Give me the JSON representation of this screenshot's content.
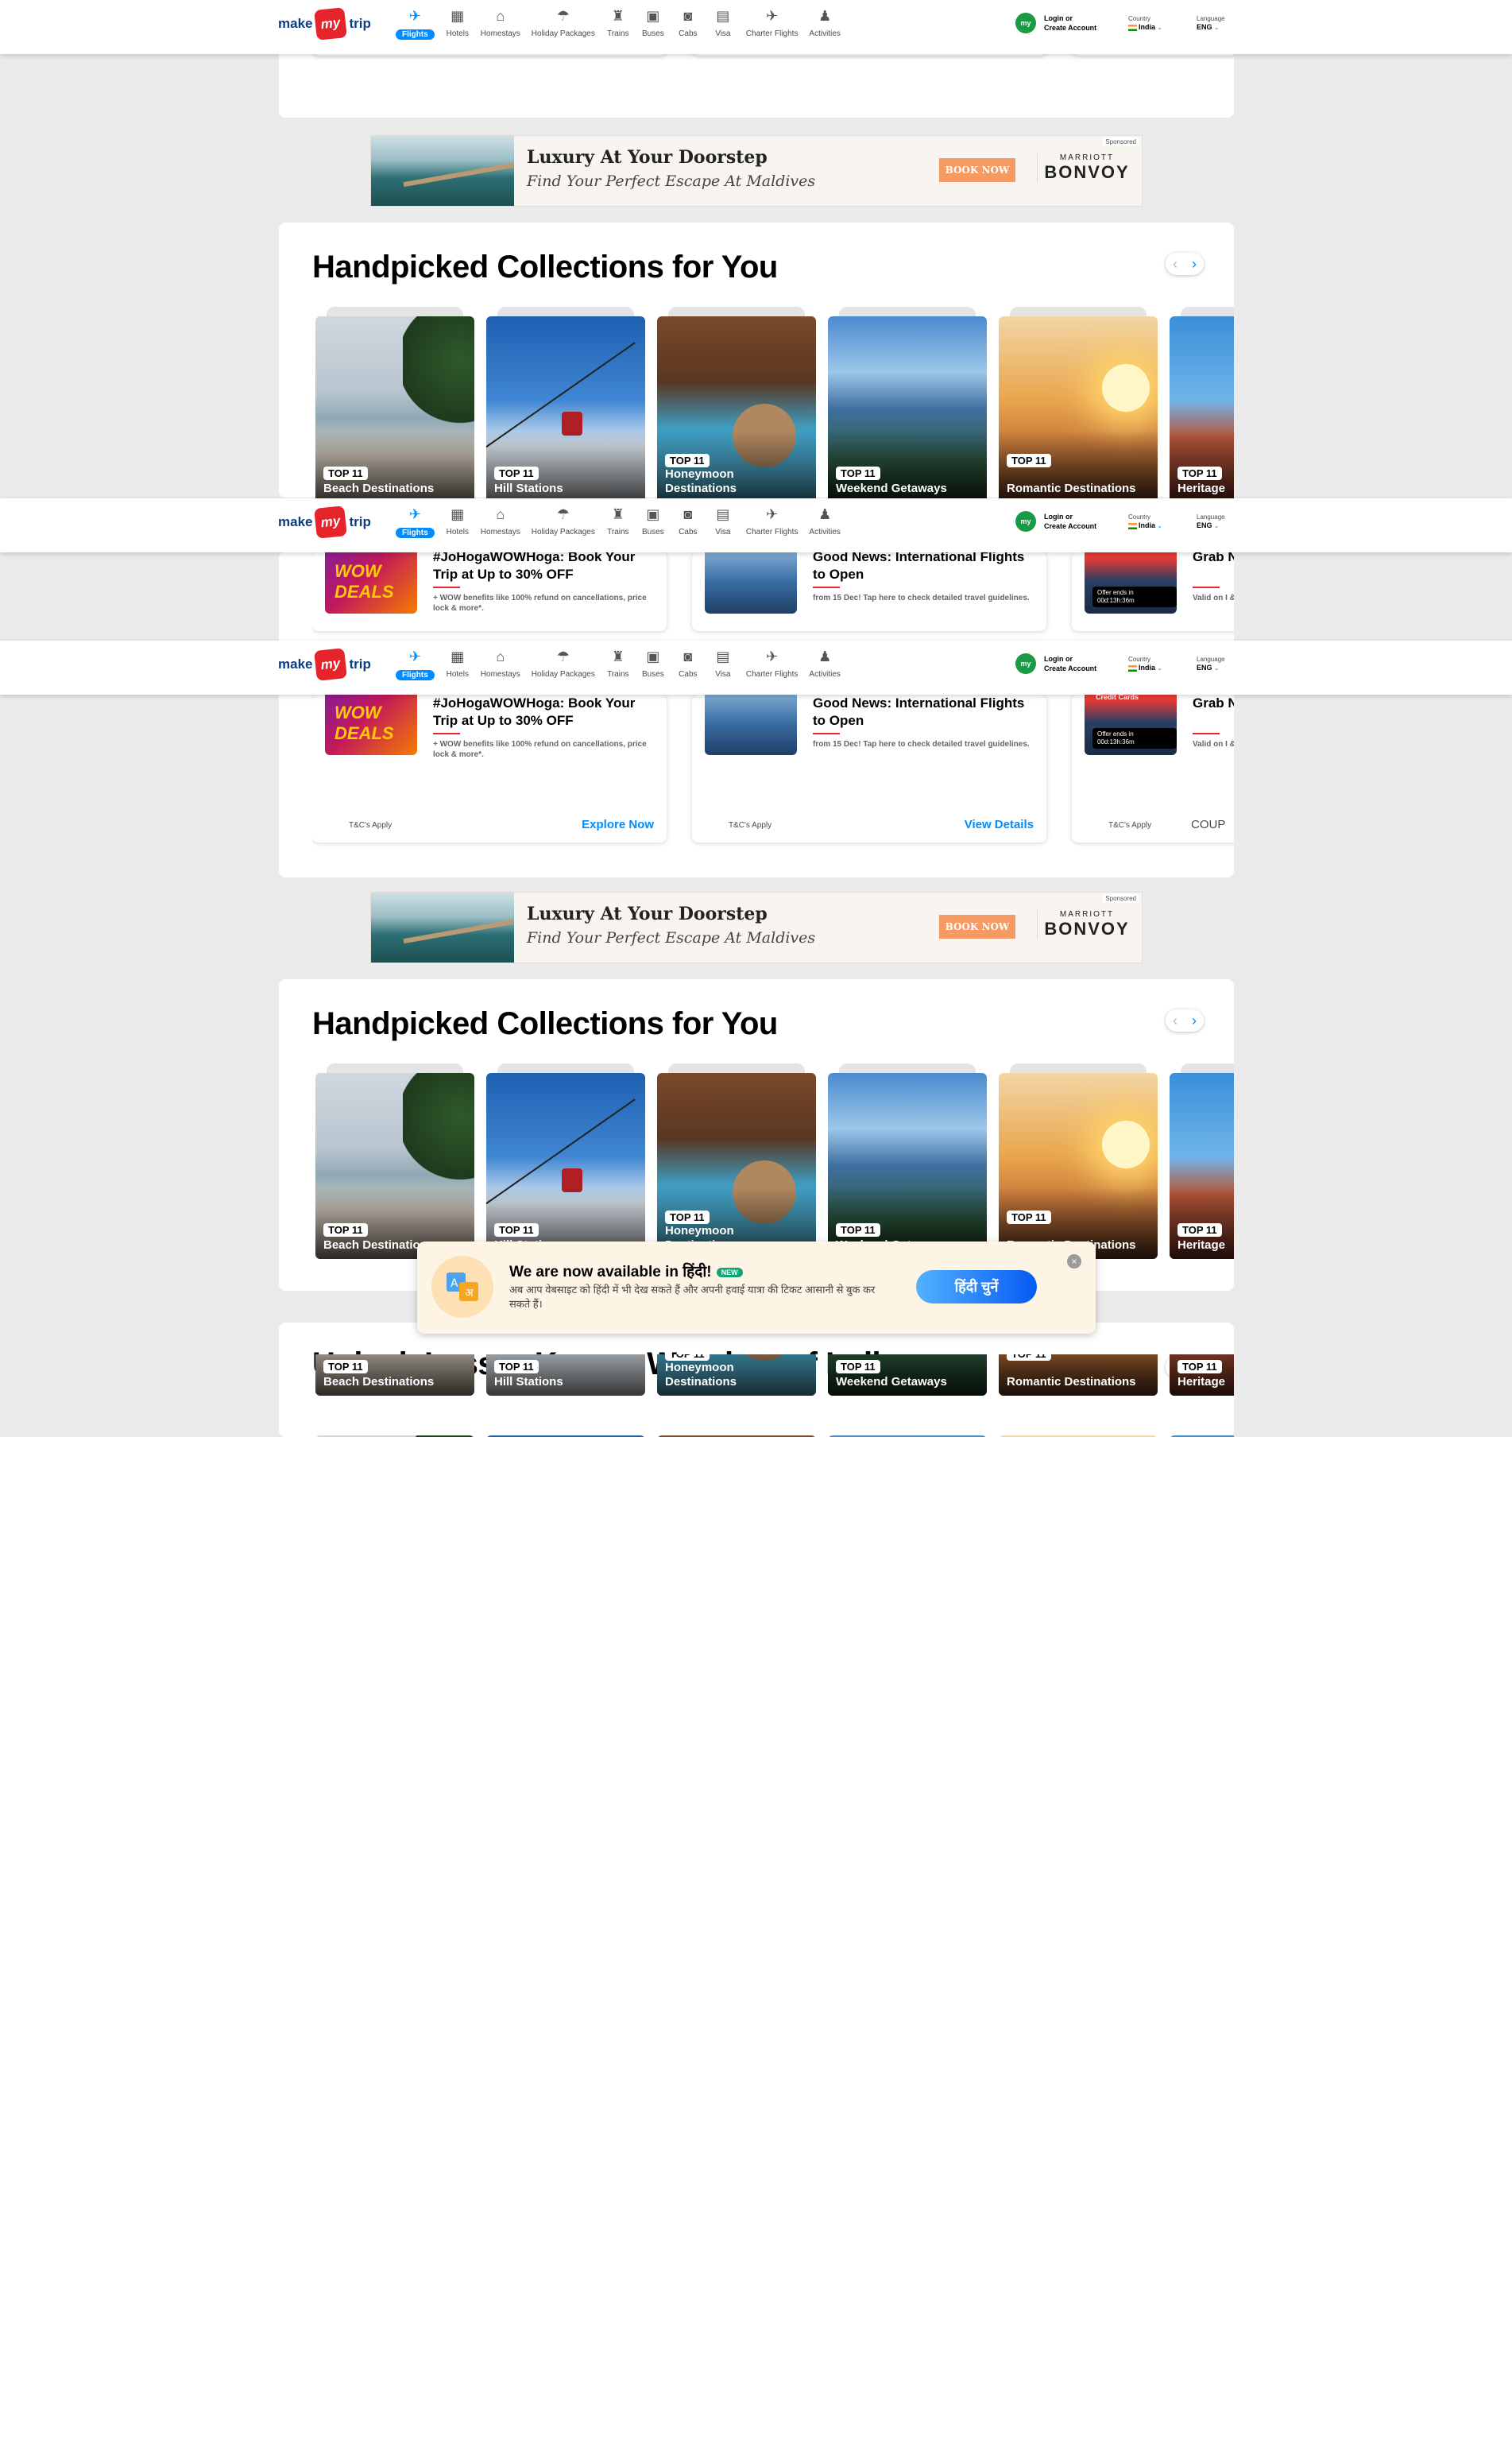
{
  "header": {
    "logo": {
      "make": "make",
      "my": "my",
      "trip": "trip"
    },
    "nav": [
      {
        "label": "Flights",
        "icon": "flight-icon"
      },
      {
        "label": "Hotels",
        "icon": "hotel-icon"
      },
      {
        "label": "Homestays",
        "icon": "homestay-icon"
      },
      {
        "label": "Holiday Packages",
        "icon": "holiday-icon"
      },
      {
        "label": "Trains",
        "icon": "train-icon"
      },
      {
        "label": "Buses",
        "icon": "bus-icon"
      },
      {
        "label": "Cabs",
        "icon": "cab-icon"
      },
      {
        "label": "Visa",
        "icon": "visa-icon"
      },
      {
        "label": "Charter Flights",
        "icon": "charter-icon"
      },
      {
        "label": "Activities",
        "icon": "activities-icon"
      }
    ],
    "account": {
      "avatar": "my",
      "line1": "Login or",
      "line2": "Create Account"
    },
    "country": {
      "label": "Country",
      "value": "India"
    },
    "language": {
      "label": "Language",
      "value": "ENG"
    }
  },
  "offers": {
    "tc": "T&C's Apply",
    "cards": [
      {
        "title": "#JoHogaWOWHoga: Book Your Trip at Up to 30% OFF",
        "desc": "+ WOW benefits like 100% refund on cancellations, price lock & more*.",
        "cta": "Explore Now",
        "thumb_text": "WOW DEALS"
      },
      {
        "title": "Good News: International Flights to Open",
        "desc": "from 15 Dec! Tap here to check detailed travel guidelines.",
        "cta": "View Details"
      },
      {
        "title": "Grab N on Dor",
        "desc": "Valid on I & Debit C",
        "cta": "COUP",
        "timer": "Offer ends in 00d:13h:36m",
        "card_text": "Credit Cards"
      }
    ]
  },
  "ad": {
    "headline": "Luxury At Your Doorstep",
    "subline": "Find Your Perfect Escape At Maldives",
    "button": "BOOK NOW",
    "brand_top": "MARRIOTT",
    "brand_bottom": "BONVOY",
    "sponsored": "Sponsored"
  },
  "collections": {
    "title": "Handpicked Collections for You",
    "badge": "TOP 11",
    "items": [
      {
        "name": "Beach Destinations"
      },
      {
        "name": "Hill Stations"
      },
      {
        "name": "Honeymoon Destinations"
      },
      {
        "name": "Weekend Getaways"
      },
      {
        "name": "Romantic Destinations"
      },
      {
        "name": "Heritage"
      }
    ]
  },
  "unlock": {
    "title": "Unlock Lesser-Known Wonders of India"
  },
  "popup": {
    "title": "We are now available in हिंदी!",
    "new_badge": "NEW",
    "desc": "अब आप वेबसाइट को हिंदी में भी देख सकते हैं और अपनी हवाई यात्रा की टिकट आसानी से बुक कर सकते हैं।",
    "button": "हिंदी चुनें",
    "close": "×"
  }
}
